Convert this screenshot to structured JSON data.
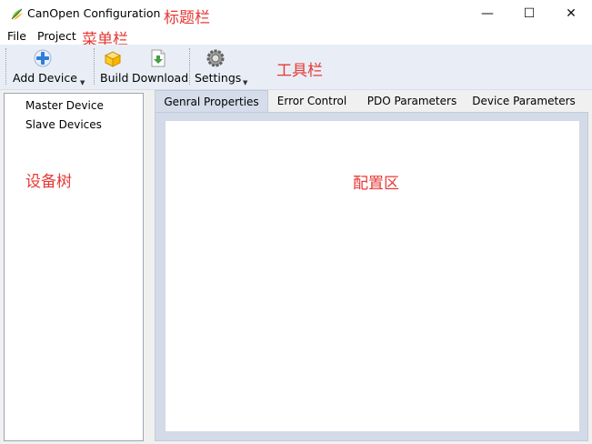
{
  "window": {
    "title": "CanOpen Configuration",
    "minimize_glyph": "—",
    "maximize_glyph": "☐",
    "close_glyph": "✕"
  },
  "annotations": {
    "title_bar": "标题栏",
    "menu_bar": "菜单栏",
    "toolbar": "工具栏",
    "device_tree": "设备树",
    "config_area": "配置区"
  },
  "menu": {
    "items": [
      {
        "label": "File"
      },
      {
        "label": "Project"
      }
    ]
  },
  "toolbar": {
    "add_device": "Add Device",
    "build": "Build",
    "download": "Download",
    "settings": "Settings",
    "dropdown_arrow": "▼"
  },
  "tree": {
    "items": [
      {
        "label": "Master Device"
      },
      {
        "label": "Slave Devices"
      }
    ]
  },
  "tabs": {
    "items": [
      {
        "label": "Genral Properties",
        "active": true
      },
      {
        "label": "Error Control",
        "active": false
      },
      {
        "label": "PDO Parameters",
        "active": false
      },
      {
        "label": "Device Parameters",
        "active": false
      }
    ]
  },
  "colors": {
    "annotation": "#e53935",
    "toolbar_bg": "#e9eef6",
    "tab_panel_bg": "#d3dae8"
  },
  "icons": {
    "app": "app-logo-icon",
    "add_device": "add-device-icon",
    "build": "build-box-icon",
    "download": "download-icon",
    "settings": "gear-icon"
  }
}
